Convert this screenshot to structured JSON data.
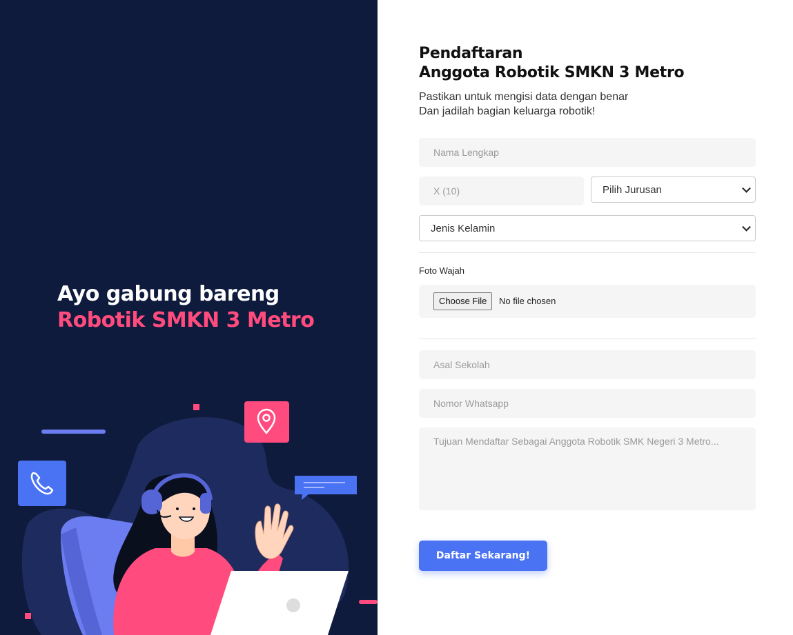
{
  "hero": {
    "line1": "Ayo gabung bareng",
    "line2": "Robotik SMKN 3 Metro"
  },
  "form": {
    "title_line1": "Pendaftaran",
    "title_line2": "Anggota Robotik SMKN 3 Metro",
    "subtitle_line1": "Pastikan untuk mengisi data dengan benar",
    "subtitle_line2": "Dan jadilah bagian keluarga robotik!",
    "nama_placeholder": "Nama Lengkap",
    "kelas_placeholder": "X (10)",
    "jurusan_selected": "Pilih Jurusan",
    "gender_selected": "Jenis Kelamin",
    "foto_label": "Foto Wajah",
    "file_button": "Choose File",
    "file_status": "No file chosen",
    "sekolah_placeholder": "Asal Sekolah",
    "whatsapp_placeholder": "Nomor Whatsapp",
    "tujuan_placeholder": "Tujuan Mendaftar Sebagai Anggota Robotik SMK Negeri 3 Metro...",
    "submit_label": "Daftar Sekarang!"
  },
  "colors": {
    "left_bg": "#0f1b3d",
    "accent_pink": "#ff4b7d",
    "accent_blue": "#4a73f4",
    "field_bg": "#f5f5f5"
  },
  "icons": [
    "phone-icon",
    "location-pin-icon",
    "chat-bubble-icon"
  ]
}
